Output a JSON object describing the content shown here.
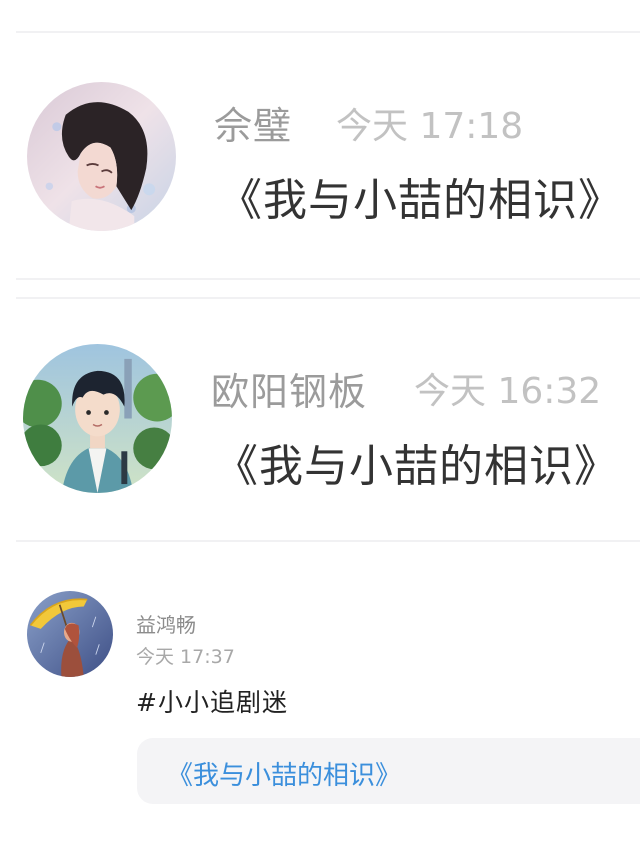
{
  "posts": [
    {
      "author": "佘璧",
      "time": "今天 17:18",
      "title": "《我与小喆的相识》",
      "avatar_icon": "girl-portrait-avatar"
    },
    {
      "author": "欧阳钢板",
      "time": "今天 16:32",
      "title": "《我与小喆的相识》",
      "avatar_icon": "boy-portrait-avatar"
    },
    {
      "author": "益鸿畅",
      "time": "今天 17:37",
      "hashtag": "#小小追剧迷",
      "link": "《我与小喆的相识》",
      "avatar_icon": "umbrella-girl-avatar"
    }
  ],
  "colors": {
    "link": "#3b8fdc",
    "card_bg": "#f4f4f6",
    "divider": "#f1f1f3"
  }
}
